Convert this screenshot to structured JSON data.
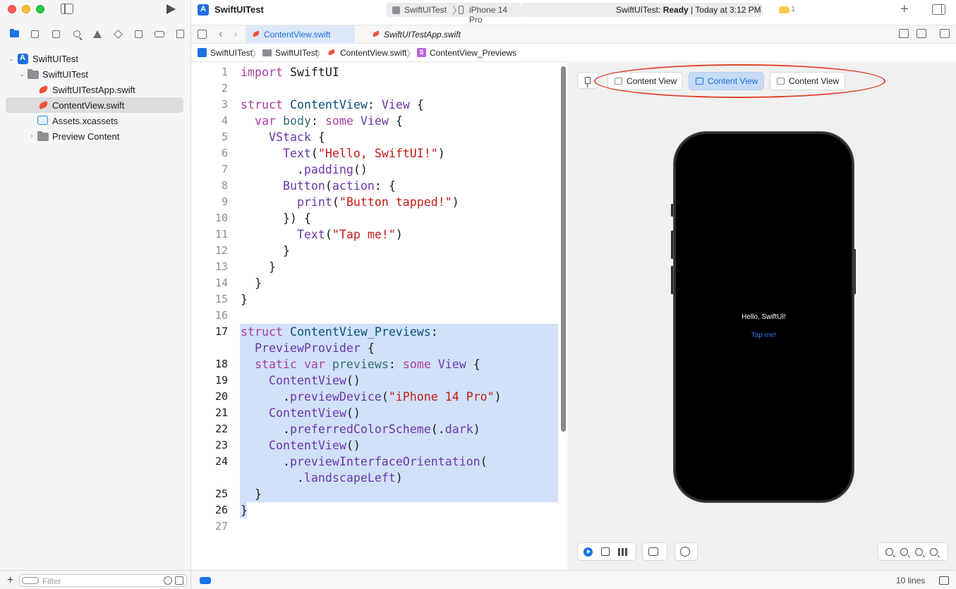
{
  "window": {
    "project_title": "SwiftUITest",
    "scheme": "SwiftUITest",
    "device": "iPhone 14 Pro",
    "status_prefix": "SwiftUITest: ",
    "status_state": "Ready",
    "status_suffix": " | Today at 3:12 PM",
    "warning_count": "1"
  },
  "sidebar": {
    "tree": [
      {
        "label": "SwiftUITest",
        "kind": "project"
      },
      {
        "label": "SwiftUITest",
        "kind": "group"
      },
      {
        "label": "SwiftUITestApp.swift",
        "kind": "swift"
      },
      {
        "label": "ContentView.swift",
        "kind": "swift",
        "selected": true
      },
      {
        "label": "Assets.xcassets",
        "kind": "assets"
      },
      {
        "label": "Preview Content",
        "kind": "group"
      }
    ],
    "filter_placeholder": "Filter"
  },
  "tabs": [
    {
      "label": "ContentView.swift",
      "active": true
    },
    {
      "label": "SwiftUITestApp.swift",
      "active": false
    }
  ],
  "breadcrumb": [
    "SwiftUITest",
    "SwiftUITest",
    "ContentView.swift",
    "ContentView_Previews"
  ],
  "code": {
    "lines": [
      {
        "num": "1",
        "html": "<span class=\"k\">import</span> SwiftUI"
      },
      {
        "num": "2",
        "html": ""
      },
      {
        "num": "3",
        "html": "<span class=\"k\">struct</span> <span class=\"t\">ContentView</span>: <span class=\"fn\">View</span> {"
      },
      {
        "num": "4",
        "html": "  <span class=\"k\">var</span> <span class=\"f\">body</span>: <span class=\"k\">some</span> <span class=\"fn\">View</span> {"
      },
      {
        "num": "5",
        "html": "    <span class=\"fn\">VStack</span> {"
      },
      {
        "num": "6",
        "html": "      <span class=\"fn\">Text</span>(<span class=\"s\">\"Hello, SwiftUI!\"</span>)"
      },
      {
        "num": "7",
        "html": "        .<span class=\"fn\">padding</span>()"
      },
      {
        "num": "8",
        "html": "      <span class=\"fn\">Button</span>(<span class=\"fn\">action</span>: {"
      },
      {
        "num": "9",
        "html": "        <span class=\"fn\">print</span>(<span class=\"s\">\"Button tapped!\"</span>)"
      },
      {
        "num": "10",
        "html": "      }) {"
      },
      {
        "num": "11",
        "html": "        <span class=\"fn\">Text</span>(<span class=\"s\">\"Tap me!\"</span>)"
      },
      {
        "num": "12",
        "html": "      }"
      },
      {
        "num": "13",
        "html": "    }"
      },
      {
        "num": "14",
        "html": "  }"
      },
      {
        "num": "15",
        "html": "}"
      },
      {
        "num": "16",
        "html": ""
      },
      {
        "num": "17",
        "html": "<span class=\"k\">struct</span> <span class=\"t\">ContentView_Previews</span>:",
        "highlight": true
      },
      {
        "num": "",
        "html": "  <span class=\"fn\">PreviewProvider</span> {",
        "highlight": true
      },
      {
        "num": "18",
        "html": "  <span class=\"k\">static</span> <span class=\"k\">var</span> <span class=\"f\">previews</span>: <span class=\"k\">some</span> <span class=\"fn\">View</span> {",
        "highlight": true
      },
      {
        "num": "19",
        "html": "    <span class=\"fn\">ContentView</span>()",
        "highlight": true
      },
      {
        "num": "20",
        "html": "      .<span class=\"fn\">previewDevice</span>(<span class=\"s\">\"iPhone 14 Pro\"</span>)",
        "highlight": true
      },
      {
        "num": "21",
        "html": "    <span class=\"fn\">ContentView</span>()",
        "highlight": true
      },
      {
        "num": "22",
        "html": "      .<span class=\"fn\">preferredColorScheme</span>(.<span class=\"fn\">dark</span>)",
        "highlight": true
      },
      {
        "num": "23",
        "html": "    <span class=\"fn\">ContentView</span>()",
        "highlight": true
      },
      {
        "num": "24",
        "html": "      .<span class=\"fn\">previewInterfaceOrientation</span>(",
        "highlight": true
      },
      {
        "num": "",
        "html": "        .<span class=\"fn\">landscapeLeft</span>)",
        "highlight": true
      },
      {
        "num": "25",
        "html": "  }",
        "highlight": true
      },
      {
        "num": "26",
        "html": "}",
        "highlight": "partial"
      },
      {
        "num": "27",
        "html": ""
      }
    ]
  },
  "preview": {
    "variants": [
      {
        "label": "Content View",
        "active": false
      },
      {
        "label": "Content View",
        "active": true
      },
      {
        "label": "Content View",
        "active": false
      }
    ],
    "device_hello": "Hello, SwiftUI!",
    "device_tap": "Tap me!"
  },
  "statusbar": {
    "lines": "10 lines"
  }
}
